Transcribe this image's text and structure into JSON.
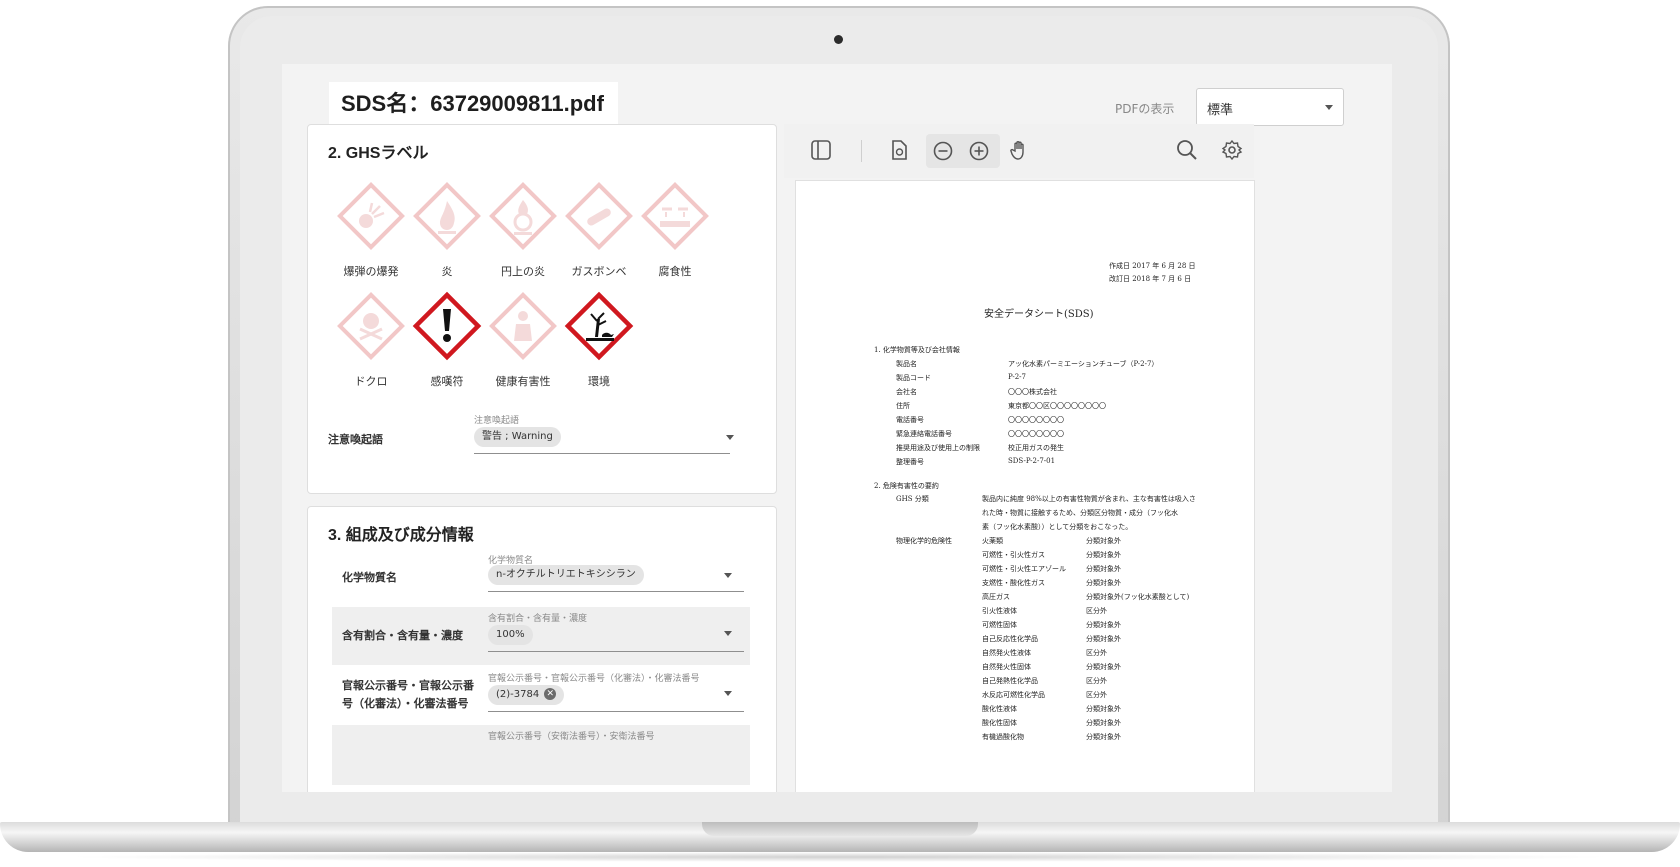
{
  "header": {
    "sds_title": "SDS名：63729009811.pdf",
    "pdf_view_label": "PDFの表示",
    "pdf_view_value": "標準"
  },
  "ghs": {
    "title": "2. GHSラベル",
    "pictograms": [
      {
        "label": "爆弾の爆発",
        "icon": "exploding-bomb-icon",
        "active": false
      },
      {
        "label": "炎",
        "icon": "flame-icon",
        "active": false
      },
      {
        "label": "円上の炎",
        "icon": "flame-over-circle-icon",
        "active": false
      },
      {
        "label": "ガスボンベ",
        "icon": "gas-cylinder-icon",
        "active": false
      },
      {
        "label": "腐食性",
        "icon": "corrosion-icon",
        "active": false
      },
      {
        "label": "ドクロ",
        "icon": "skull-crossbones-icon",
        "active": false
      },
      {
        "label": "感嘆符",
        "icon": "exclamation-mark-icon",
        "active": true
      },
      {
        "label": "健康有害性",
        "icon": "health-hazard-icon",
        "active": false
      },
      {
        "label": "環境",
        "icon": "environment-icon",
        "active": true
      }
    ],
    "signal_word": {
      "label": "注意喚起語",
      "caption": "注意喚起語",
      "value": "警告 ; Warning"
    },
    "colors": {
      "active": "#d0181f",
      "inactive": "#f2c7c7"
    }
  },
  "composition": {
    "title": "3. 組成及び成分情報",
    "rows": [
      {
        "label": "化学物質名",
        "caption": "化学物質名",
        "value": "n-オクチルトリエトキシシラン",
        "removable": false
      },
      {
        "label": "含有割合・含有量・濃度",
        "caption": "含有割合・含有量・濃度",
        "value": "100%",
        "removable": false
      },
      {
        "label_line1": "官報公示番号・官報公示番",
        "label_line2": "号（化審法）・化審法番号",
        "caption": "官報公示番号・官報公示番号（化審法）・化審法番号",
        "value": "(2)-3784",
        "removable": true
      },
      {
        "caption": "官報公示番号（安衛法番号）・安衛法番号"
      }
    ]
  },
  "pdf_viewer": {
    "toolbar_icons": [
      "sidebar-toggle-icon",
      "file-icon",
      "zoom-out-icon",
      "zoom-in-icon",
      "hand-pan-icon",
      "search-icon",
      "settings-icon"
    ],
    "document": {
      "date_line1": "作成日 2017 年 6 月 28 日",
      "date_line2": "改訂日 2018 年 7 月 6 日",
      "title": "安全データシート(SDS)",
      "section1": {
        "heading": "1. 化学物質等及び会社情報",
        "items": [
          {
            "k": "製品名",
            "v": "アッ化水素パーミエーションチューブ（P-2-7）"
          },
          {
            "k": "製品コード",
            "v": "P-2-7"
          },
          {
            "k": "会社名",
            "v": "〇〇〇株式会社"
          },
          {
            "k": "住所",
            "v": "東京都〇〇区〇〇〇〇〇〇〇〇"
          },
          {
            "k": "電話番号",
            "v": "〇〇〇〇〇〇〇〇"
          },
          {
            "k": "緊急連絡電話番号",
            "v": "〇〇〇〇〇〇〇〇"
          },
          {
            "k": "推奨用途及び使用上の制限",
            "v": "校正用ガスの発生"
          },
          {
            "k": "整理番号",
            "v": "SDS-P-2-7-01"
          }
        ]
      },
      "section2": {
        "heading": "2. 危険有害性の要約",
        "ghs_key": "GHS 分類",
        "ghs_text": [
          "製品内に純度 98%以上の有害性物質が含まれ、主な有害性は吸入さ",
          "れた時・物質に接触するため、分類区分物質・成分（フッ化水",
          "素（フッ化水素酸））として分類をおこなった。"
        ],
        "phys_key": "物理化学的危険性",
        "hazards": [
          {
            "k": "火薬類",
            "v": "分類対象外"
          },
          {
            "k": "可燃性・引火性ガス",
            "v": "分類対象外"
          },
          {
            "k": "可燃性・引火性エアゾール",
            "v": "分類対象外"
          },
          {
            "k": "支燃性・酸化性ガス",
            "v": "分類対象外"
          },
          {
            "k": "高圧ガス",
            "v": "分類対象外(フッ化水素酸として)"
          },
          {
            "k": "引火性液体",
            "v": "区分外"
          },
          {
            "k": "可燃性固体",
            "v": "分類対象外"
          },
          {
            "k": "自己反応性化学品",
            "v": "分類対象外"
          },
          {
            "k": "自然発火性液体",
            "v": "区分外"
          },
          {
            "k": "自然発火性固体",
            "v": "分類対象外"
          },
          {
            "k": "自己発熱性化学品",
            "v": "区分外"
          },
          {
            "k": "水反応可燃性化学品",
            "v": "区分外"
          },
          {
            "k": "酸化性液体",
            "v": "分類対象外"
          },
          {
            "k": "酸化性固体",
            "v": "分類対象外"
          },
          {
            "k": "有機過酸化物",
            "v": "分類対象外"
          }
        ]
      }
    }
  }
}
